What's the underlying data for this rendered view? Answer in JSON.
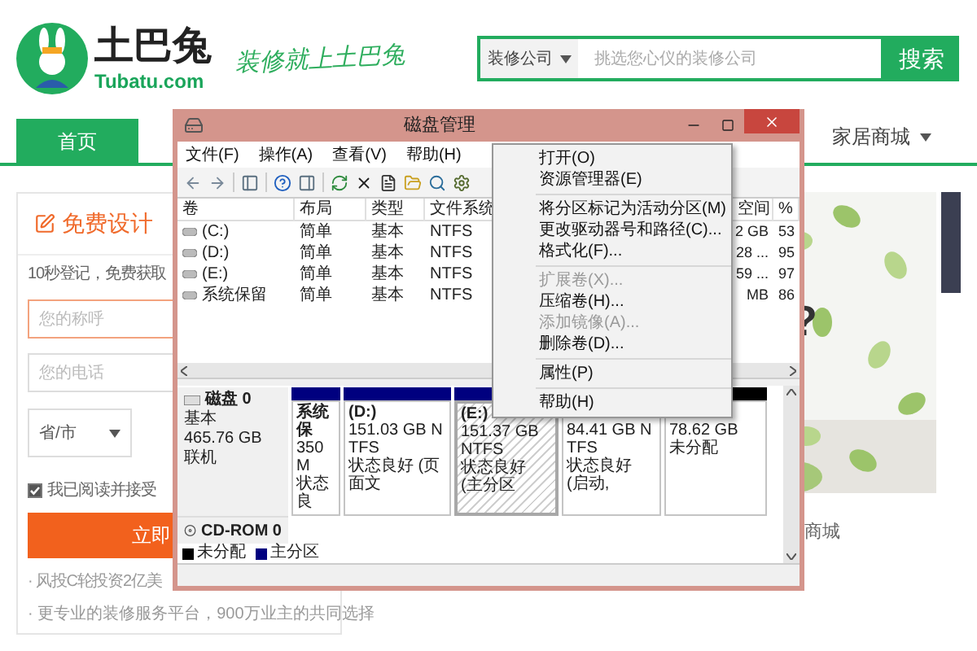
{
  "header": {
    "logo_name": "土巴兔",
    "logo_domain": "Tubatu.com",
    "slogan": "装修就上土巴兔",
    "search": {
      "category": "装修公司",
      "placeholder": "挑选您心仪的装修公司",
      "button": "搜索"
    }
  },
  "nav": {
    "items": [
      {
        "label": "首页",
        "selected": true
      }
    ],
    "mall": "家居商城"
  },
  "form": {
    "title": "免费设计",
    "intro": "10秒登记，免费获取",
    "fields": [
      {
        "placeholder": "您的称呼",
        "focused": true
      },
      {
        "placeholder": "您的电话",
        "focused": false
      }
    ],
    "region": "省/市",
    "agree": {
      "label": "我已阅读并接受",
      "checked": true
    },
    "submit": "立即",
    "notes": [
      "· 风投C轮投资2亿美",
      "· 更专业的装修服务平台，900万业主的共同选择"
    ]
  },
  "feature": {
    "question": "?",
    "mall_label": "商城"
  },
  "window": {
    "title": "磁盘管理",
    "menu": [
      "文件(F)",
      "操作(A)",
      "查看(V)",
      "帮助(H)"
    ],
    "table": {
      "columns": [
        "卷",
        "布局",
        "类型",
        "文件系统",
        "空间",
        "%"
      ],
      "rows": [
        {
          "cells": [
            "(C:)",
            "简单",
            "基本",
            "NTFS",
            "2 GB",
            "53"
          ]
        },
        {
          "cells": [
            "(D:)",
            "简单",
            "基本",
            "NTFS",
            "28 ...",
            "95"
          ]
        },
        {
          "cells": [
            "(E:)",
            "简单",
            "基本",
            "NTFS",
            "59 ...",
            "97"
          ]
        },
        {
          "cells": [
            "系统保留",
            "简单",
            "基本",
            "NTFS",
            "MB",
            "86"
          ]
        }
      ]
    },
    "disks": [
      {
        "name": "磁盘 0",
        "type": "基本",
        "size": "465.76 GB",
        "status": "联机",
        "partitions": [
          {
            "kind": "primary",
            "name": "系统保",
            "size": "350 M",
            "status": "状态良",
            "selected": false
          },
          {
            "kind": "primary",
            "name": "(D:)",
            "size": "151.03 GB NTFS",
            "status": "状态良好 (页面文",
            "selected": false
          },
          {
            "kind": "primary",
            "name": "(E:)",
            "size": "151.37 GB NTFS",
            "status": "状态良好 (主分区",
            "selected": true
          },
          {
            "size": "84.41 GB NTFS",
            "status": "状态良好 (启动,",
            "selected": false
          },
          {
            "kind": "unallocated",
            "size": "78.62 GB",
            "status": "未分配",
            "selected": false
          }
        ]
      }
    ],
    "cdrom": "CD-ROM 0",
    "legend": [
      {
        "label": "未分配",
        "color": "#000000"
      },
      {
        "label": "主分区",
        "color": "#00007f"
      }
    ]
  },
  "context_menu": {
    "items": [
      {
        "kind": "item",
        "label": "打开(O)",
        "disabled": false
      },
      {
        "kind": "item",
        "label": "资源管理器(E)",
        "disabled": false
      },
      {
        "kind": "separator"
      },
      {
        "kind": "item",
        "label": "将分区标记为活动分区(M)",
        "disabled": false
      },
      {
        "kind": "item",
        "label": "更改驱动器号和路径(C)...",
        "disabled": false
      },
      {
        "kind": "item",
        "label": "格式化(F)...",
        "disabled": false
      },
      {
        "kind": "separator"
      },
      {
        "kind": "item",
        "label": "扩展卷(X)...",
        "disabled": true
      },
      {
        "kind": "item",
        "label": "压缩卷(H)...",
        "disabled": false
      },
      {
        "kind": "item",
        "label": "添加镜像(A)...",
        "disabled": true
      },
      {
        "kind": "item",
        "label": "删除卷(D)...",
        "disabled": false
      },
      {
        "kind": "separator"
      },
      {
        "kind": "item",
        "label": "属性(P)",
        "disabled": false
      },
      {
        "kind": "separator"
      },
      {
        "kind": "item",
        "label": "帮助(H)",
        "disabled": false
      }
    ]
  }
}
